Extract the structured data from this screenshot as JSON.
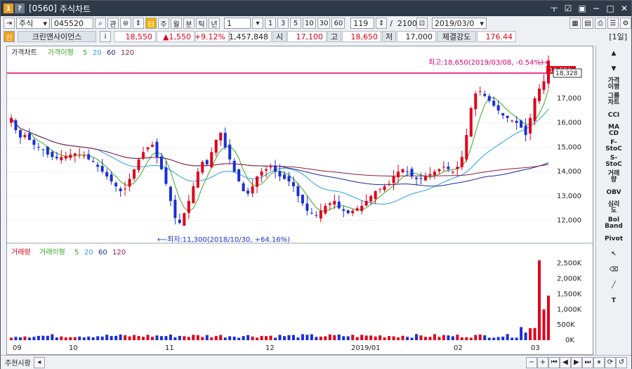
{
  "window": {
    "id": "[0560]",
    "title": "주식차트"
  },
  "toolbar": {
    "market": "주식",
    "code": "045520",
    "btn_search": "⌕",
    "btn_watch": "관",
    "periods": [
      "주",
      "월",
      "분",
      "틱",
      "년"
    ],
    "interval_value": "1",
    "minute_presets": [
      "1",
      "3",
      "5",
      "10",
      "30",
      "60"
    ],
    "count": "119",
    "total": "2100",
    "date": "2019/03/0"
  },
  "info": {
    "badge": "신",
    "name": "크린앤사이언스",
    "info_btn": "i",
    "price": "18,550",
    "change": "▲1,550",
    "pct": "+9.12%",
    "volume": "1,457,848",
    "open_label": "시",
    "open": "17,100",
    "high_label": "고",
    "high": "18,650",
    "low_label": "저",
    "low": "17,000",
    "strength_label": "체결강도",
    "strength": "176.44",
    "period_badge": "[1일]"
  },
  "price_panel": {
    "title": "가격차트",
    "ma_label": "가격이평",
    "ma_periods": [
      "5",
      "20",
      "60",
      "120"
    ],
    "high_note": "최고:18,650(2019/03/08, -0.54%)",
    "low_note": "최저:11,300(2018/10/30, +64.16%)",
    "current_tag": "18,550",
    "cross_tag": "18,328"
  },
  "volume_panel": {
    "title": "거래량",
    "ma_label": "거래이평",
    "ma_periods": [
      "5",
      "20",
      "60",
      "120"
    ]
  },
  "colors": {
    "up": "#e0001c",
    "down": "#1a2fd8",
    "ma5": "#3aa820",
    "ma20": "#27a0e0",
    "ma60": "#1b2a9a",
    "ma120": "#8a2040",
    "hline": "#e0006a"
  },
  "chart_data": [
    {
      "type": "candlestick",
      "title": "가격차트",
      "y_ticks": [
        12000,
        13000,
        14000,
        15000,
        16000,
        17000,
        18000
      ],
      "ylim": [
        11300,
        18900
      ],
      "high": 18650,
      "low": 11300,
      "x_labels": [
        "09",
        "10",
        "11",
        "12",
        "2019/01",
        "02",
        "03"
      ],
      "series": [
        {
          "name": "close",
          "values": [
            16200,
            15700,
            15400,
            15500,
            15300,
            15100,
            15000,
            14900,
            14700,
            14600,
            14550,
            14600,
            14650,
            14700,
            14750,
            14700,
            14650,
            14500,
            14400,
            14200,
            14000,
            13800,
            13600,
            13400,
            13200,
            13300,
            13700,
            14100,
            14500,
            14800,
            15000,
            15100,
            14600,
            14100,
            13500,
            12800,
            12100,
            11900,
            12300,
            12800,
            13400,
            14000,
            14400,
            14300,
            14800,
            15300,
            15600,
            15000,
            14500,
            14000,
            13600,
            13200,
            13100,
            13400,
            13800,
            14000,
            14100,
            14200,
            14000,
            13800,
            13700,
            13600,
            13400,
            13000,
            12700,
            12400,
            12300,
            12200,
            12400,
            12600,
            12700,
            12800,
            12500,
            12400,
            12300,
            12400,
            12500,
            12600,
            12800,
            13000,
            13200,
            13300,
            13400,
            13500,
            13800,
            14000,
            14100,
            14000,
            13800,
            13700,
            13700,
            13800,
            13900,
            14000,
            14100,
            14200,
            14100,
            14000,
            14200,
            14600,
            15500,
            16600,
            17200,
            17300,
            17100,
            16900,
            16700,
            16500,
            16300,
            16200,
            16100,
            16000,
            15800,
            15500,
            16200,
            17000,
            17400,
            17700,
            18550
          ]
        }
      ]
    },
    {
      "type": "bar",
      "title": "거래량",
      "y_ticks": [
        "0K",
        "500K",
        "1,000K",
        "1,500K",
        "2,000K",
        "2,500K"
      ],
      "ylim": [
        0,
        2700
      ]
    }
  ]
}
